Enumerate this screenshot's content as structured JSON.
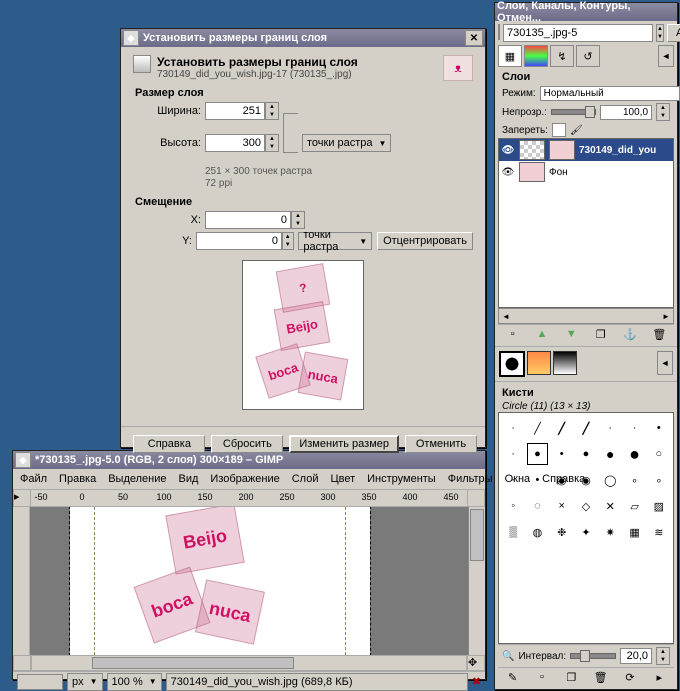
{
  "dialog": {
    "title": "Установить размеры границ слоя",
    "header_title": "Установить размеры границ слоя",
    "header_sub": "730149_did_you_wish.jpg-17 (730135_.jpg)",
    "frame_size": "Размер слоя",
    "width_label": "Ширина:",
    "height_label": "Высота:",
    "width_val": "251",
    "height_val": "300",
    "units": "точки растра",
    "info_dims": "251 × 300 точек растра",
    "info_ppi": "72 ppi",
    "frame_offset": "Смещение",
    "x_label": "X:",
    "y_label": "Y:",
    "x_val": "0",
    "y_val": "0",
    "center_btn": "Отцентрировать",
    "help_btn": "Справка",
    "reset_btn": "Сбросить",
    "apply_btn": "Изменить размер",
    "cancel_btn": "Отменить"
  },
  "editor": {
    "title": "*730135_.jpg-5.0 (RGB, 2 слоя) 300×189 – GIMP",
    "menu": [
      "Файл",
      "Правка",
      "Выделение",
      "Вид",
      "Изображение",
      "Слой",
      "Цвет",
      "Инструменты",
      "Фильтры",
      "Окна",
      "Справка"
    ],
    "ruler_ticks": [
      "-50",
      "0",
      "50",
      "100",
      "150",
      "200",
      "250",
      "300",
      "350",
      "400",
      "450"
    ],
    "status": {
      "unit": "px",
      "zoom": "100 %",
      "file": "730149_did_you_wish.jpg (689,8 КБ)"
    }
  },
  "dock": {
    "title": "Слои, Каналы, Контуры, Отмен...",
    "image_name": "730135_.jpg-5",
    "auto_btn": "Авто",
    "layers_title": "Слои",
    "mode_label": "Режим:",
    "mode_value": "Нормальный",
    "opacity_label": "Непрозр.:",
    "opacity_value": "100,0",
    "lock_label": "Запереть:",
    "layers": [
      "730149_did_you",
      "Фон"
    ],
    "brushes_title": "Кисти",
    "brush_name": "Circle (11) (13 × 13)",
    "interval_label": "Интервал:",
    "interval_value": "20,0"
  }
}
